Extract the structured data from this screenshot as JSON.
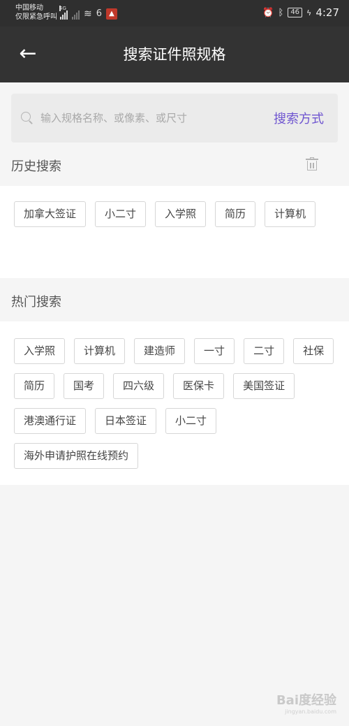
{
  "status_bar": {
    "carrier_line1": "中国移动",
    "carrier_line2": "仅限紧急呼叫",
    "network_tag": "4G",
    "icon_wifi": "wifi-icon",
    "icon_app": "6",
    "battery": "46",
    "time": "4:27"
  },
  "header": {
    "back_icon": "←",
    "title": "搜索证件照规格"
  },
  "search": {
    "placeholder": "输入规格名称、或像素、或尺寸",
    "mode_label": "搜索方式"
  },
  "history": {
    "title": "历史搜索",
    "items": [
      "加拿大签证",
      "小二寸",
      "入学照",
      "简历",
      "计算机"
    ]
  },
  "hot": {
    "title": "热门搜索",
    "items": [
      "入学照",
      "计算机",
      "建造师",
      "一寸",
      "二寸",
      "社保",
      "简历",
      "国考",
      "四六级",
      "医保卡",
      "美国签证",
      "港澳通行证",
      "日本签证",
      "小二寸",
      "海外申请护照在线预约"
    ]
  },
  "watermark": {
    "brand": "Bai度经验",
    "url": "jingyan.baidu.com"
  },
  "colors": {
    "accent": "#6f55d0",
    "navbar": "#333333",
    "background": "#f5f5f5"
  }
}
